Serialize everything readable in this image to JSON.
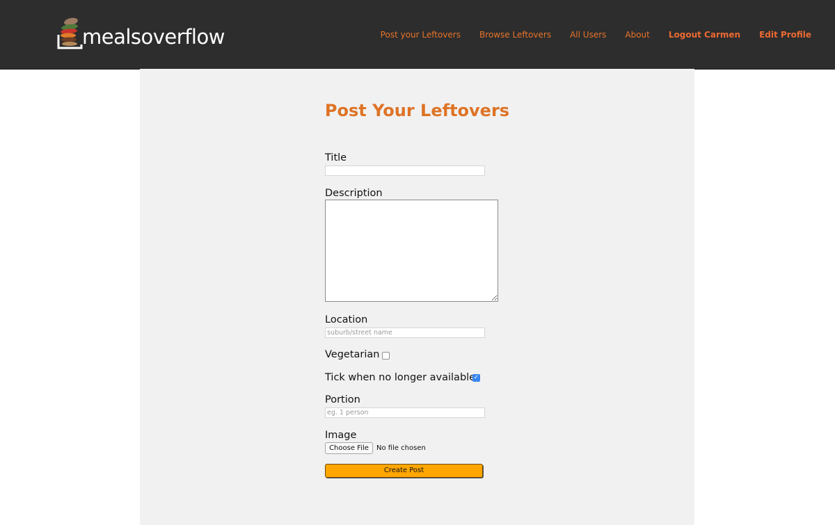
{
  "brand": {
    "name": "mealsoverflow",
    "logo_icon": "stacked-food-plate-icon"
  },
  "nav": {
    "items": [
      {
        "label": "Post your Leftovers"
      },
      {
        "label": "Browse Leftovers"
      },
      {
        "label": "All Users"
      },
      {
        "label": "About"
      },
      {
        "label": "Logout Carmen"
      },
      {
        "label": "Edit Profile"
      }
    ]
  },
  "page": {
    "title": "Post Your Leftovers"
  },
  "form": {
    "title": {
      "label": "Title",
      "value": ""
    },
    "description": {
      "label": "Description",
      "value": ""
    },
    "location": {
      "label": "Location",
      "value": "",
      "placeholder": "suburb/street name"
    },
    "vegetarian": {
      "label": "Vegetarian",
      "checked": false
    },
    "unavailable": {
      "label": "Tick when no longer available",
      "checked": true
    },
    "portion": {
      "label": "Portion",
      "value": "",
      "placeholder": "eg. 1 person"
    },
    "image": {
      "label": "Image",
      "button_label": "Choose File",
      "status": "No file chosen"
    },
    "submit_label": "Create Post"
  },
  "colors": {
    "navbar_bg": "#2d2d2d",
    "accent": "#e8732a",
    "title": "#de7326",
    "panel_bg": "#f1f1f1",
    "submit_bg": "#ffa600",
    "checkbox_checked": "#3a86f0"
  }
}
